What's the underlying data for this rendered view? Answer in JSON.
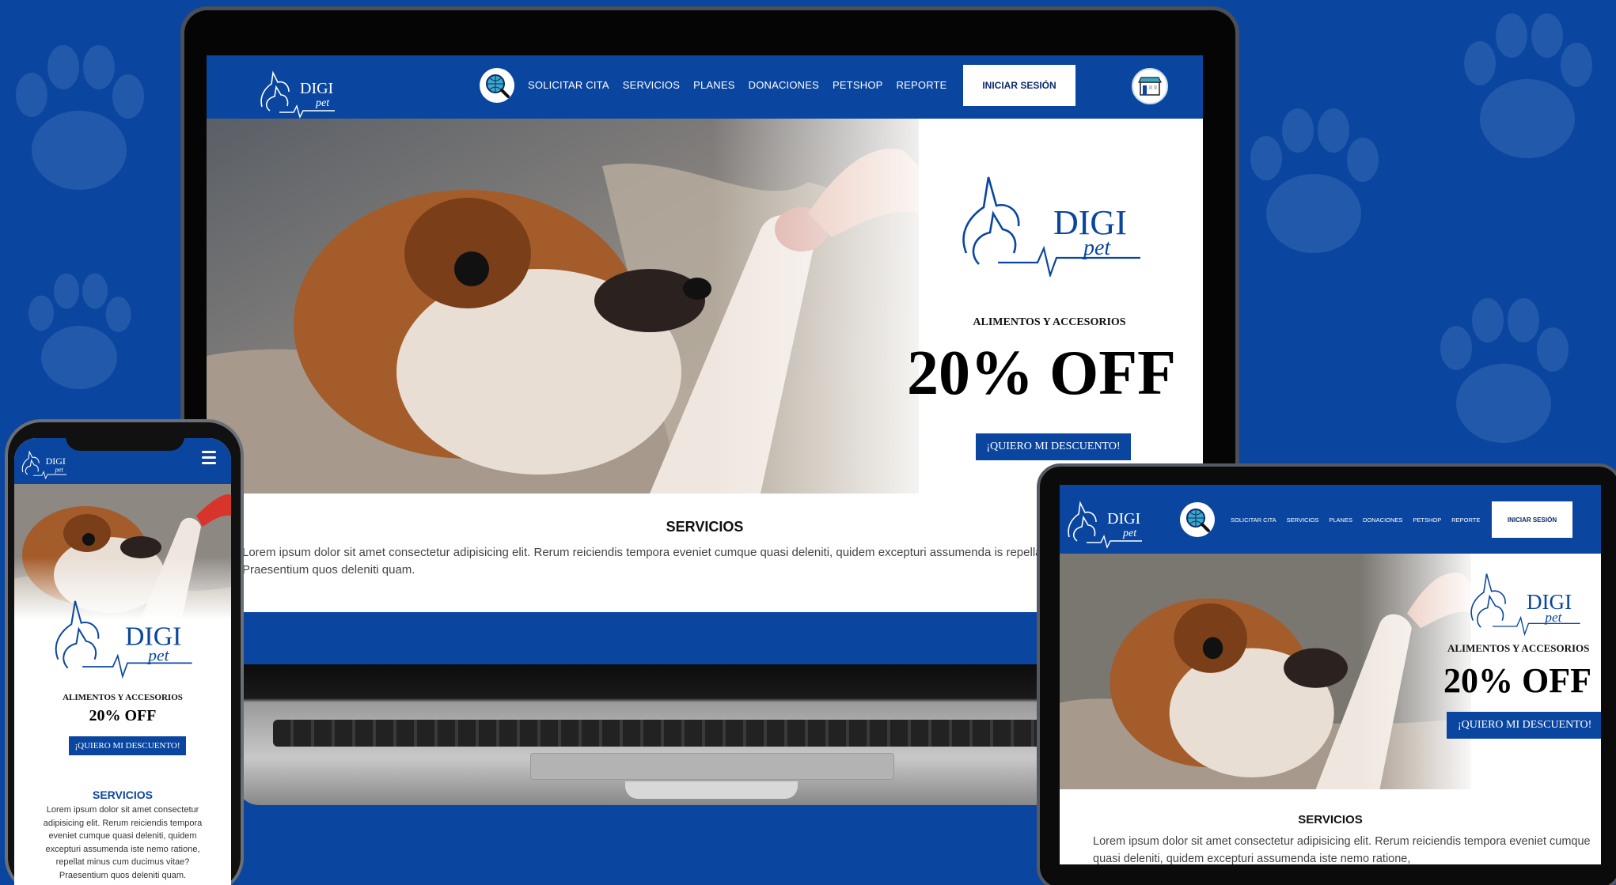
{
  "brand": {
    "name_top": "DIGI",
    "name_bottom": "pet",
    "accent": "#0a46a0",
    "text_dark": "#0a2a6b"
  },
  "nav": {
    "items": [
      "SOLICITAR CITA",
      "SERVICIOS",
      "PLANES",
      "DONACIONES",
      "PETSHOP",
      "REPORTE"
    ],
    "login_label": "INICIAR SESIÓN",
    "search_icon": "globe-search-icon",
    "cart_icon": "petshop-store-icon",
    "menu_icon": "hamburger-menu-icon"
  },
  "hero": {
    "subtitle": "ALIMENTOS Y ACCESORIOS",
    "discount": "20% OFF",
    "cta_label": "¡QUIERO MI DESCUENTO!"
  },
  "services": {
    "title": "SERVICIOS",
    "laptop_text": "Lorem ipsum dolor sit amet consectetur adipisicing elit. Rerum reiciendis tempora eveniet cumque quasi deleniti, quidem excepturi assumenda is repellat minus cum ducimus vitae? Praesentium quos deleniti quam.",
    "phone_text": "Lorem ipsum dolor sit amet consectetur adipisicing elit. Rerum reiciendis tempora eveniet cumque quasi deleniti, quidem excepturi assumenda iste nemo ratione, repellat minus cum ducimus vitae? Praesentium quos deleniti quam.",
    "tablet_text": "Lorem ipsum dolor sit amet consectetur adipisicing elit. Rerum reiciendis tempora eveniet cumque quasi deleniti, quidem excepturi assumenda iste nemo ratione,"
  }
}
